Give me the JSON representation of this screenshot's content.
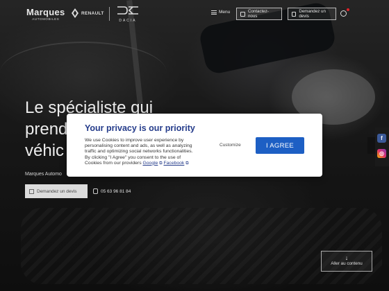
{
  "header": {
    "brand_name": "Marques",
    "brand_sub": "AUTOMOBILES",
    "renault": "RENAULT",
    "dacia": "DACIA",
    "menu_label": "Menu",
    "contact_label": "Contactez-nous",
    "quote_label": "Demandez un devis"
  },
  "hero": {
    "title_line1": "Le spécialiste qui",
    "title_line2": "prend",
    "title_line3": "véhic",
    "subtitle": "Marques Automo",
    "cta_quote": "Demandez un devis",
    "cta_phone": "05 63 96 81 84",
    "scroll_label": "Aller au contenu"
  },
  "cookie_dialog": {
    "title": "Your privacy is our priority",
    "body": "We use Cookies to improve user experience by personalising content and ads, as well as analyzing traffic and optimizing social networks functionalities. By clicking \"I Agree\" you consent to the use of Cookies from our providers",
    "link_google": "Google",
    "link_facebook": "Facebook",
    "customize_label": "Customize",
    "agree_label": "I AGREE"
  },
  "side_social": {
    "facebook": "f",
    "instagram": "◎"
  },
  "colors": {
    "primary_blue": "#1d5fc4",
    "title_blue": "#253c8b",
    "notification_red": "#e2222a"
  }
}
